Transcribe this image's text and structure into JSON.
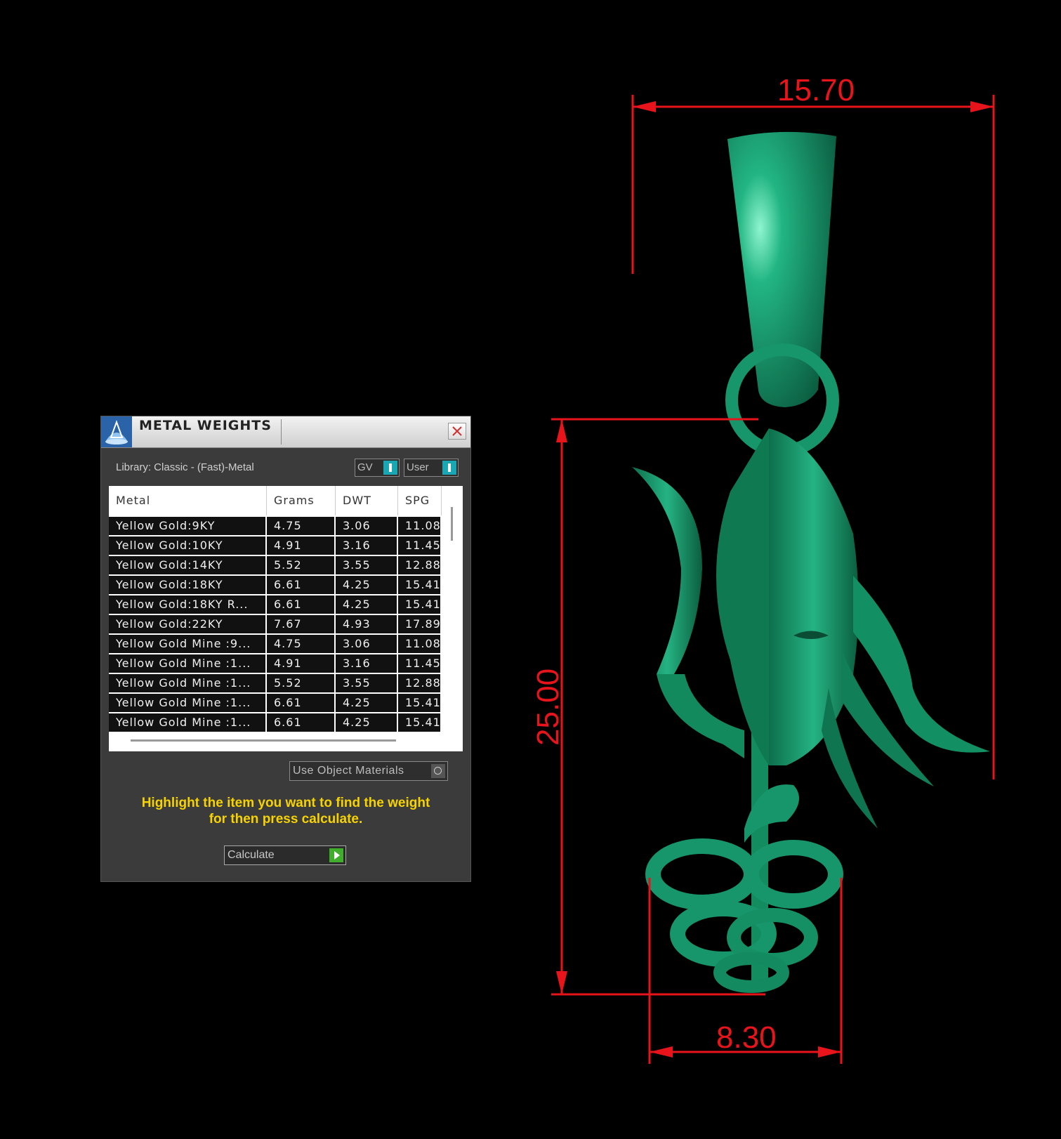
{
  "window": {
    "title": "METAL WEIGHTS"
  },
  "library": {
    "label": "Library: Classic - (Fast)-Metal"
  },
  "toggles": {
    "gv": "GV",
    "user": "User"
  },
  "table": {
    "columns": [
      "Metal",
      "Grams",
      "DWT",
      "SPG"
    ],
    "rows": [
      [
        "Yellow Gold:9KY",
        "4.75",
        "3.06",
        "11.08"
      ],
      [
        "Yellow Gold:10KY",
        "4.91",
        "3.16",
        "11.45"
      ],
      [
        "Yellow Gold:14KY",
        "5.52",
        "3.55",
        "12.88"
      ],
      [
        "Yellow Gold:18KY",
        "6.61",
        "4.25",
        "15.41"
      ],
      [
        "Yellow Gold:18KY R...",
        "6.61",
        "4.25",
        "15.41"
      ],
      [
        "Yellow Gold:22KY",
        "7.67",
        "4.93",
        "17.89"
      ],
      [
        "Yellow Gold Mine :9...",
        "4.75",
        "3.06",
        "11.08"
      ],
      [
        "Yellow Gold Mine :1...",
        "4.91",
        "3.16",
        "11.45"
      ],
      [
        "Yellow Gold Mine :1...",
        "5.52",
        "3.55",
        "12.88"
      ],
      [
        "Yellow Gold Mine :1...",
        "6.61",
        "4.25",
        "15.41"
      ],
      [
        "Yellow Gold Mine :1...",
        "6.61",
        "4.25",
        "15.41"
      ]
    ]
  },
  "use_object_materials": "Use Object Materials",
  "instruction": {
    "line1": "Highlight the item you want to find the weight",
    "line2": "for then press calculate."
  },
  "calculate_label": "Calculate",
  "dimensions": {
    "width": "15.70",
    "height": "25.00",
    "base": "8.30"
  },
  "colors": {
    "dimension": "#e8141c",
    "model": "#1a9a6a",
    "instruction": "#f5d200",
    "toggle_knob": "#1aa6b3",
    "calculate_icon": "#3fae2a"
  },
  "icons": {
    "app": "rhino-logo-icon",
    "close": "close-icon",
    "toggle": "toggle-switch-icon",
    "materials": "circle-option-icon",
    "calculate": "play-arrow-icon"
  }
}
